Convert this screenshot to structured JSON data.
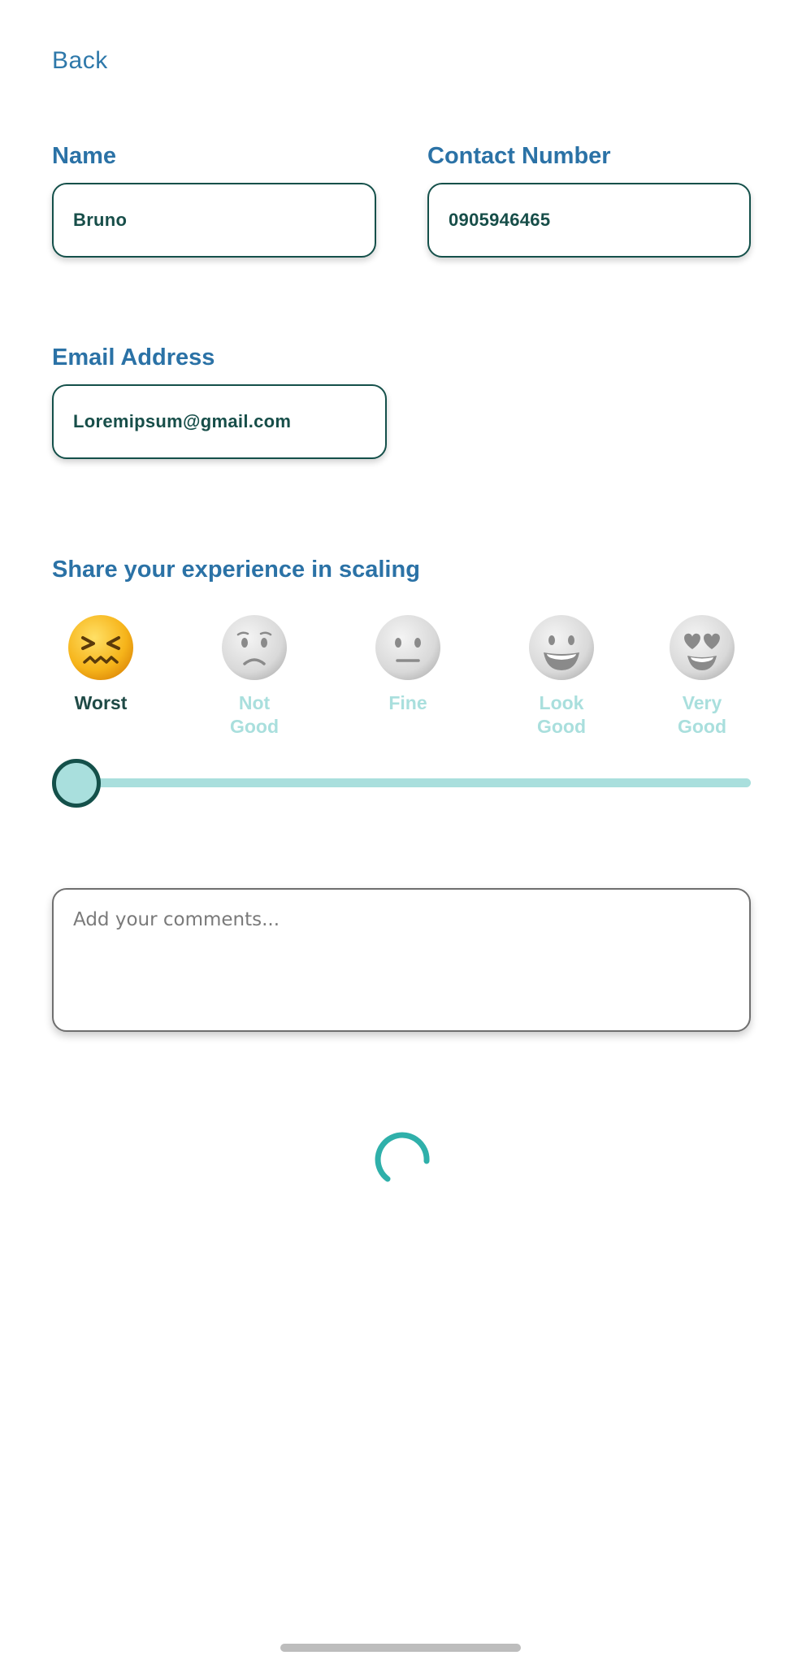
{
  "nav": {
    "back_label": "Back"
  },
  "form": {
    "name": {
      "label": "Name",
      "value": "Bruno"
    },
    "contact": {
      "label": "Contact Number",
      "value": "0905946465"
    },
    "email": {
      "label": "Email Address",
      "value": "Loremipsum@gmail.com"
    }
  },
  "experience": {
    "title": "Share your experience in scaling",
    "options": [
      {
        "line1": "Worst",
        "line2": "",
        "icon": "confounded-face-icon"
      },
      {
        "line1": "Not",
        "line2": "Good",
        "icon": "worried-face-icon"
      },
      {
        "line1": "Fine",
        "line2": "",
        "icon": "neutral-face-icon"
      },
      {
        "line1": "Look",
        "line2": "Good",
        "icon": "grinning-face-icon"
      },
      {
        "line1": "Very",
        "line2": "Good",
        "icon": "heart-eyes-face-icon"
      }
    ],
    "selected_index": 0,
    "slider_value": 0
  },
  "comments": {
    "placeholder": "Add your comments..."
  },
  "colors": {
    "label_blue": "#2b72a6",
    "field_border": "#14504a",
    "field_text": "#174e49",
    "selected_label": "#1f4a46",
    "unselected_label": "#a9dfdd",
    "slider_track": "#a9dfdd",
    "spinner": "#2fb0aa"
  }
}
